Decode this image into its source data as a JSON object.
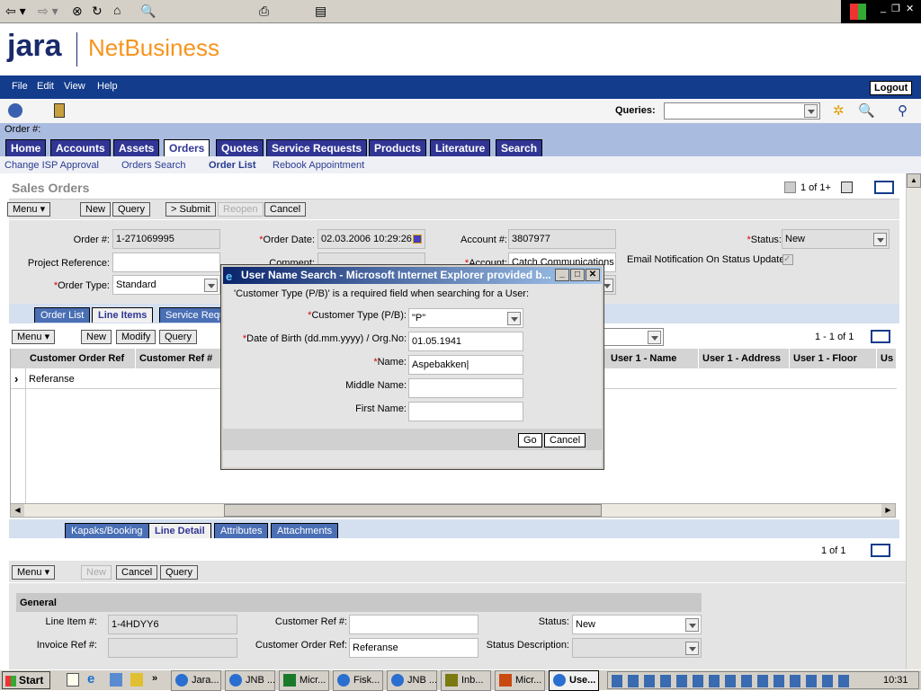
{
  "browser": {
    "toolbar_icons": [
      "back-icon",
      "forward-icon",
      "stop-icon",
      "refresh-icon",
      "home-icon",
      "search-icon",
      "favorites-icon",
      "media-icon",
      "history-icon",
      "edit-icon",
      "print-icon",
      "word-icon",
      "discuss-icon",
      "messenger-icon"
    ]
  },
  "logo": {
    "brand": "jara",
    "product": "NetBusiness",
    "brand_color": "#1a2a6c",
    "product_color": "#f7941d"
  },
  "menubar": {
    "items": [
      "File",
      "Edit",
      "View",
      "Help"
    ],
    "logout": "Logout"
  },
  "queries": {
    "label": "Queries:",
    "value": ""
  },
  "context": {
    "label": "Order #:"
  },
  "tabs": [
    {
      "label": "Home"
    },
    {
      "label": "Accounts"
    },
    {
      "label": "Assets"
    },
    {
      "label": "Orders",
      "active": true
    },
    {
      "label": "Quotes"
    },
    {
      "label": "Service Requests"
    },
    {
      "label": "Products"
    },
    {
      "label": "Literature"
    },
    {
      "label": "Search"
    }
  ],
  "subnav": [
    {
      "label": "Change ISP Approval"
    },
    {
      "label": "Orders Search"
    },
    {
      "label": "Order List",
      "active": true
    },
    {
      "label": "Rebook Appointment"
    }
  ],
  "page": {
    "title": "Sales Orders",
    "pager": "1 of 1+"
  },
  "form": {
    "toolbar": {
      "menu": "Menu",
      "new": "New",
      "query": "Query",
      "submit": "> Submit",
      "reopen": "Reopen",
      "cancel": "Cancel"
    },
    "order_no_label": "Order #:",
    "order_no": "1-271069995",
    "order_date_label": "Order Date:",
    "order_date": "02.03.2006 10:29:26",
    "account_no_label": "Account #:",
    "account_no": "3807977",
    "status_label": "Status:",
    "status": "New",
    "project_ref_label": "Project Reference:",
    "project_ref": "",
    "comment_label": "Comment:",
    "account_label": "Account:",
    "account": "Catch Communications",
    "email_label": "Email Notification On Status Update:",
    "email_checked": true,
    "order_type_label": "Order Type:",
    "order_type": "Standard"
  },
  "list": {
    "tabs": [
      {
        "label": "Order List"
      },
      {
        "label": "Line Items",
        "active": true
      },
      {
        "label": "Service Requests"
      }
    ],
    "toolbar": {
      "menu": "Menu",
      "new": "New",
      "modify": "Modify",
      "query": "Query"
    },
    "pager": "1 - 1 of 1",
    "columns": [
      "Customer Order Ref",
      "Customer Ref #",
      "User 1 - Name",
      "User 1 - Address",
      "User 1 - Floor",
      "Us"
    ],
    "rows": [
      {
        "customer_order_ref": "Referanse"
      }
    ]
  },
  "detail": {
    "tabs": [
      {
        "label": "Kapaks/Booking"
      },
      {
        "label": "Line Detail",
        "active": true
      },
      {
        "label": "Attributes"
      },
      {
        "label": "Attachments"
      }
    ],
    "pager": "1 of 1",
    "toolbar": {
      "menu": "Menu",
      "new": "New",
      "cancel": "Cancel",
      "query": "Query"
    },
    "section": "General",
    "line_item_label": "Line Item #:",
    "line_item": "1-4HDYY6",
    "invoice_ref_label": "Invoice Ref #:",
    "invoice_ref": "",
    "cust_ref_label": "Customer Ref #:",
    "cust_ref": "",
    "cust_order_ref_label": "Customer Order Ref:",
    "cust_order_ref": "Referanse",
    "status_label": "Status:",
    "status": "New",
    "status_desc_label": "Status Description:",
    "status_desc": ""
  },
  "dialog": {
    "title": "User Name Search - Microsoft Internet Explorer provided b...",
    "message": "'Customer Type (P/B)' is a required field when searching for a User:",
    "customer_type_label": "Customer Type (P/B):",
    "customer_type": "\"P\"",
    "dob_label": "Date of Birth (dd.mm.yyyy) / Org.No:",
    "dob": "01.05.1941",
    "name_label": "Name:",
    "name": "Aspebakken",
    "middle_label": "Middle Name:",
    "middle": "",
    "first_label": "First Name:",
    "first": "",
    "go": "Go",
    "cancel": "Cancel"
  },
  "taskbar": {
    "start": "Start",
    "tasks": [
      "Jara...",
      "JNB ...",
      "Micr...",
      "Fisk...",
      "JNB ...",
      "Inb...",
      "Micr...",
      "Use..."
    ],
    "clock": "10:31"
  }
}
